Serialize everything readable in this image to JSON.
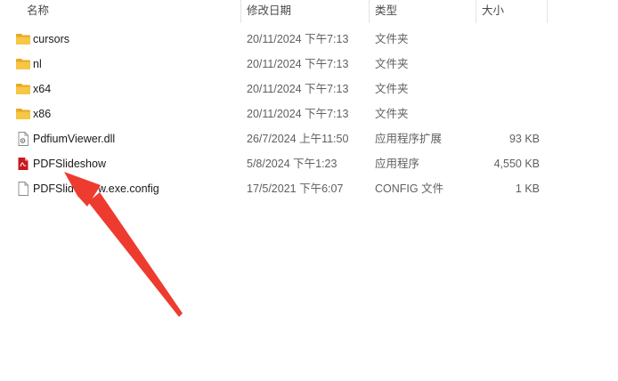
{
  "columns": {
    "name": "名称",
    "date": "修改日期",
    "type": "类型",
    "size": "大小"
  },
  "files": [
    {
      "name": "cursors",
      "date": "20/11/2024 下午7:13",
      "type": "文件夹",
      "size": "",
      "icon": "folder-icon"
    },
    {
      "name": "nl",
      "date": "20/11/2024 下午7:13",
      "type": "文件夹",
      "size": "",
      "icon": "folder-icon"
    },
    {
      "name": "x64",
      "date": "20/11/2024 下午7:13",
      "type": "文件夹",
      "size": "",
      "icon": "folder-icon"
    },
    {
      "name": "x86",
      "date": "20/11/2024 下午7:13",
      "type": "文件夹",
      "size": "",
      "icon": "folder-icon"
    },
    {
      "name": "PdfiumViewer.dll",
      "date": "26/7/2024 上午11:50",
      "type": "应用程序扩展",
      "size": "93 KB",
      "icon": "dll-file-icon"
    },
    {
      "name": "PDFSlideshow",
      "date": "5/8/2024 下午1:23",
      "type": "应用程序",
      "size": "4,550 KB",
      "icon": "pdf-app-icon"
    },
    {
      "name": "PDFSlideshow.exe.config",
      "date": "17/5/2021 下午6:07",
      "type": "CONFIG 文件",
      "size": "1 KB",
      "icon": "config-file-icon"
    }
  ],
  "colors": {
    "folder": "#f6c644",
    "folder_dark": "#e8a825",
    "annotation_arrow": "#ee3b2f",
    "app_icon": "#c8191e"
  }
}
